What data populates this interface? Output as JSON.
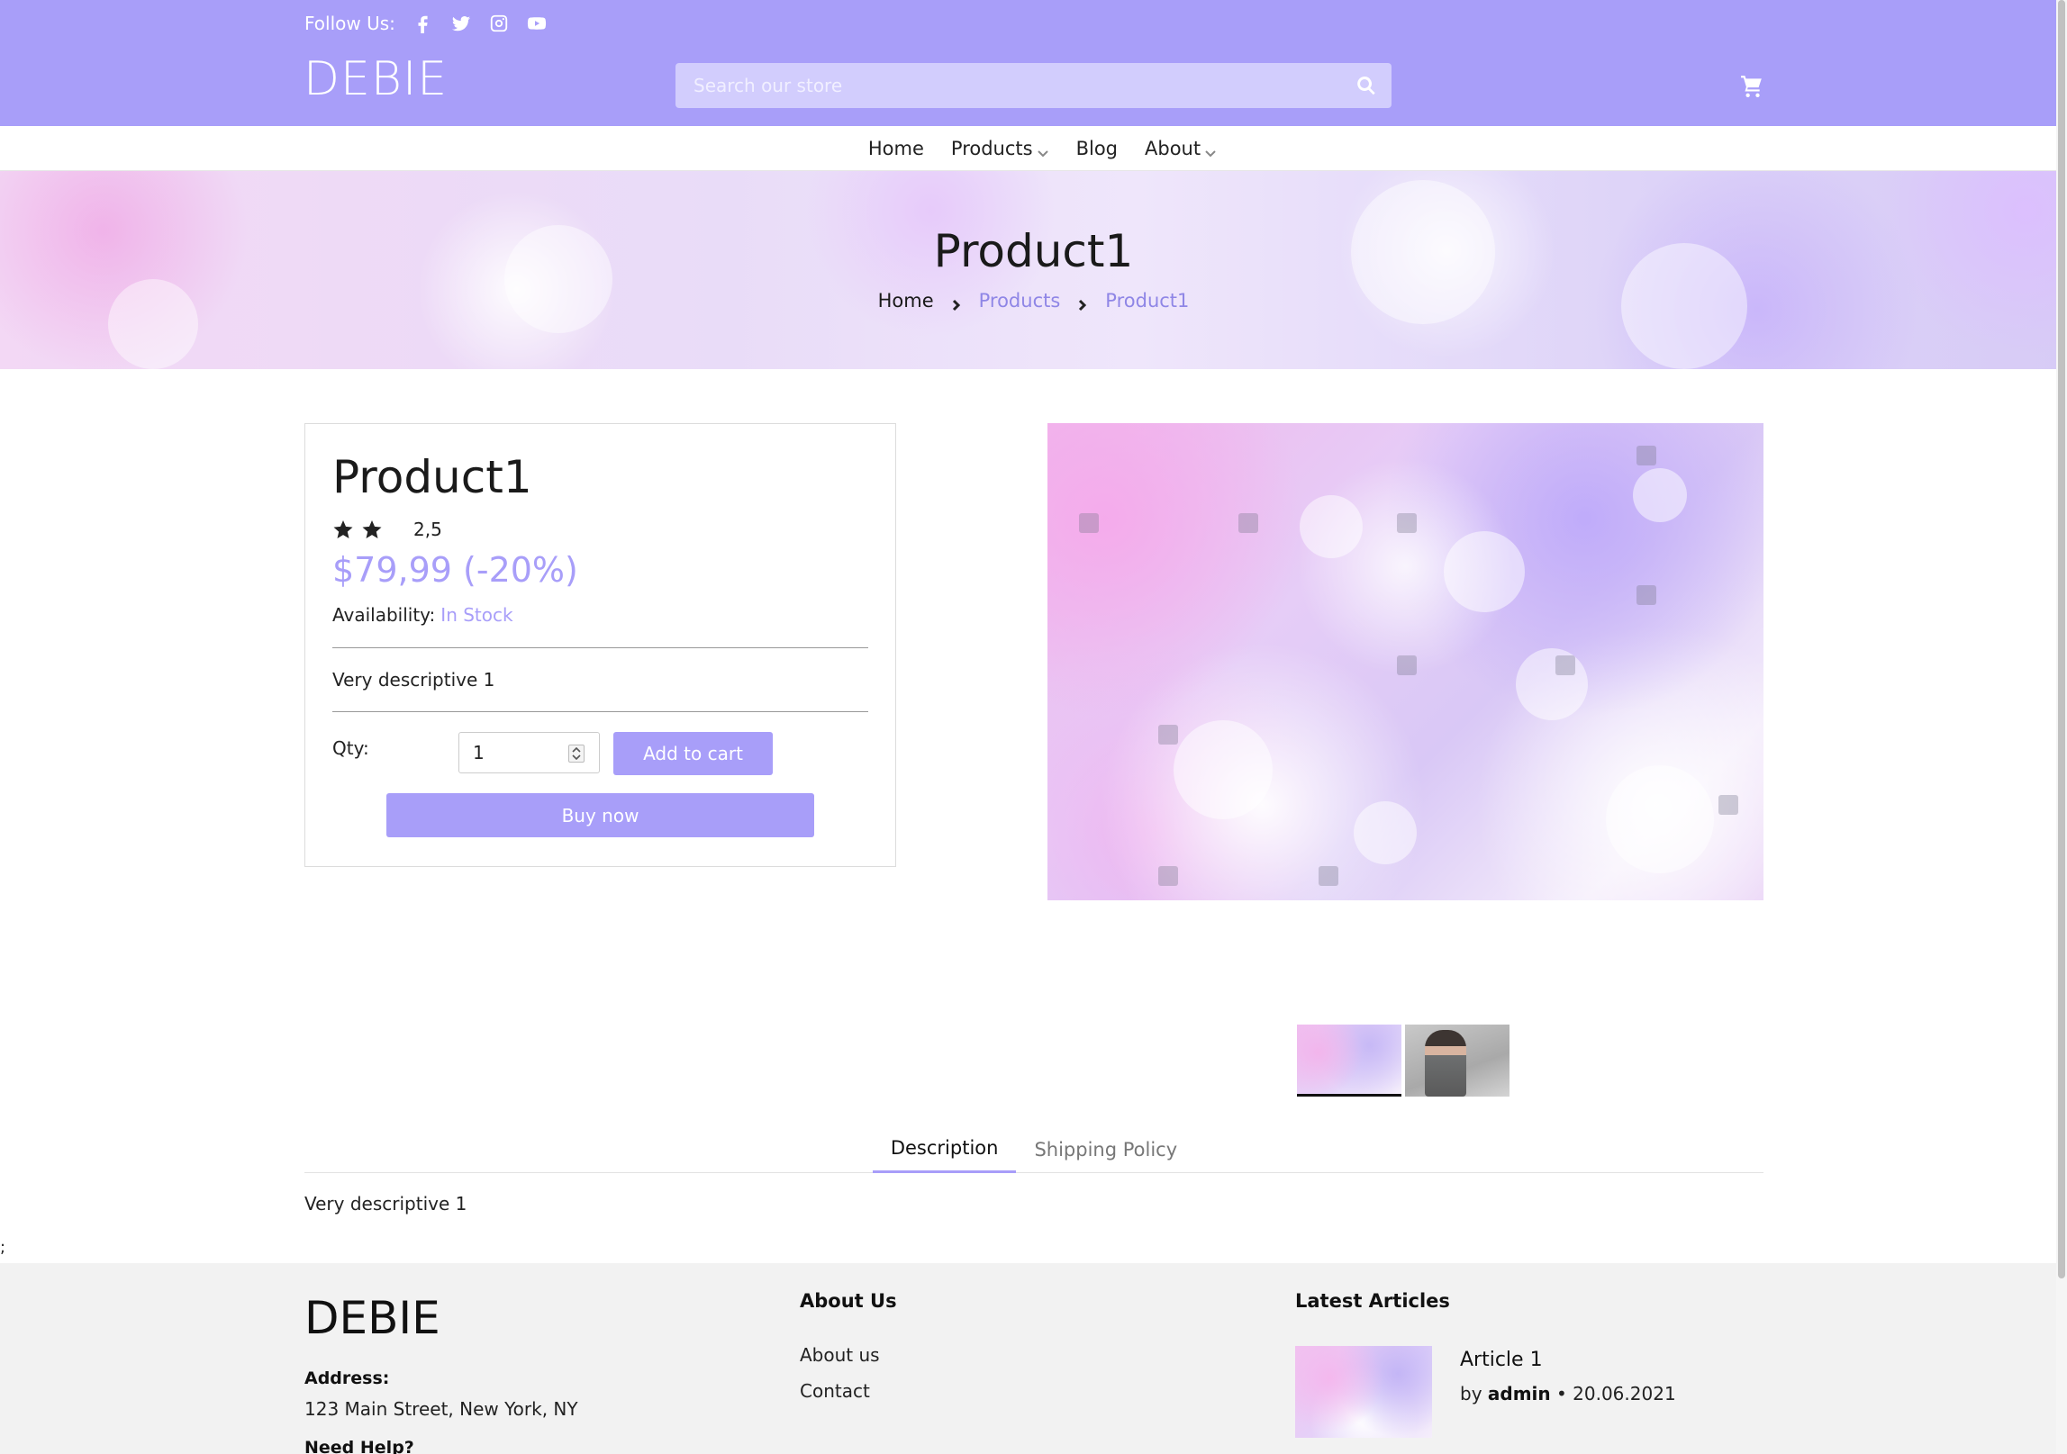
{
  "header": {
    "follow_label": "Follow Us:",
    "social": [
      "facebook-icon",
      "twitter-icon",
      "instagram-icon",
      "youtube-icon"
    ],
    "logo": "DEBIE",
    "search_placeholder": "Search our store",
    "accent_color": "#a89ef9"
  },
  "nav": {
    "items": [
      {
        "label": "Home",
        "dropdown": false
      },
      {
        "label": "Products",
        "dropdown": true
      },
      {
        "label": "Blog",
        "dropdown": false
      },
      {
        "label": "About",
        "dropdown": true
      }
    ]
  },
  "hero": {
    "title": "Product1",
    "breadcrumb": [
      "Home",
      "Products",
      "Product1"
    ]
  },
  "product": {
    "name": "Product1",
    "stars_filled": 2,
    "stars_total": 5,
    "rating_text": "2,5",
    "price": "$79,99 (-20%)",
    "availability_label": "Availability:",
    "availability_value": "In Stock",
    "short_description": "Very descriptive 1",
    "qty_label": "Qty:",
    "qty_value": "1",
    "add_to_cart": "Add to cart",
    "buy_now": "Buy now"
  },
  "tabs": {
    "items": [
      "Description",
      "Shipping Policy"
    ],
    "active": "Description",
    "body": "Very descriptive 1"
  },
  "stray_text": ";",
  "footer": {
    "logo": "DEBIE",
    "address_heading": "Address:",
    "address": "123 Main Street, New York, NY",
    "help_heading": "Need Help?",
    "about_heading": "About Us",
    "about_links": [
      "About us",
      "Contact"
    ],
    "articles_heading": "Latest Articles",
    "article": {
      "title": "Article 1",
      "by": "by",
      "author": "admin",
      "date": "• 20.06.2021"
    }
  }
}
